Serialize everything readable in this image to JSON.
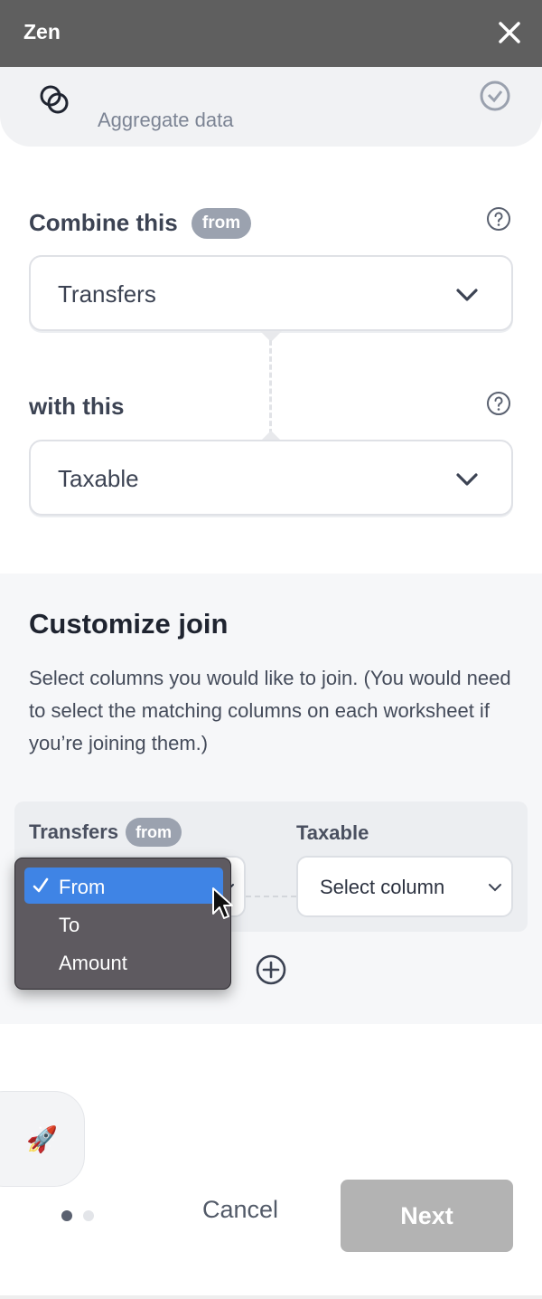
{
  "header": {
    "title": "Zen",
    "close_icon": "close-icon"
  },
  "aggregate": {
    "label": "Aggregate data",
    "icon": "join-circles-icon",
    "check_icon": "check-circle-icon"
  },
  "combine": {
    "label": "Combine this",
    "badge": "from",
    "help_icon": "question-circle-icon",
    "selected": "Transfers"
  },
  "with": {
    "label": "with this",
    "help_icon": "question-circle-icon",
    "selected": "Taxable"
  },
  "customize": {
    "title": "Customize join",
    "description": "Select columns you would like to join. (You would need to select the matching columns on each worksheet if you’re joining them.)",
    "left_table": "Transfers",
    "left_badge": "from",
    "right_table": "Taxable",
    "right_select_value": "Select column",
    "add_icon": "plus-circle-icon"
  },
  "dropdown": {
    "options": [
      {
        "label": "From",
        "selected": true
      },
      {
        "label": "To",
        "selected": false
      },
      {
        "label": "Amount",
        "selected": false
      }
    ]
  },
  "footer": {
    "rocket_emoji": "🚀",
    "cancel_label": "Cancel",
    "next_label": "Next",
    "pagination": {
      "current": 1,
      "total": 2
    }
  },
  "colors": {
    "header_bg": "#5f5f5f",
    "badge_bg": "#9ba2af",
    "selected_option": "#3f84e5",
    "next_disabled": "#b3b3b3"
  }
}
